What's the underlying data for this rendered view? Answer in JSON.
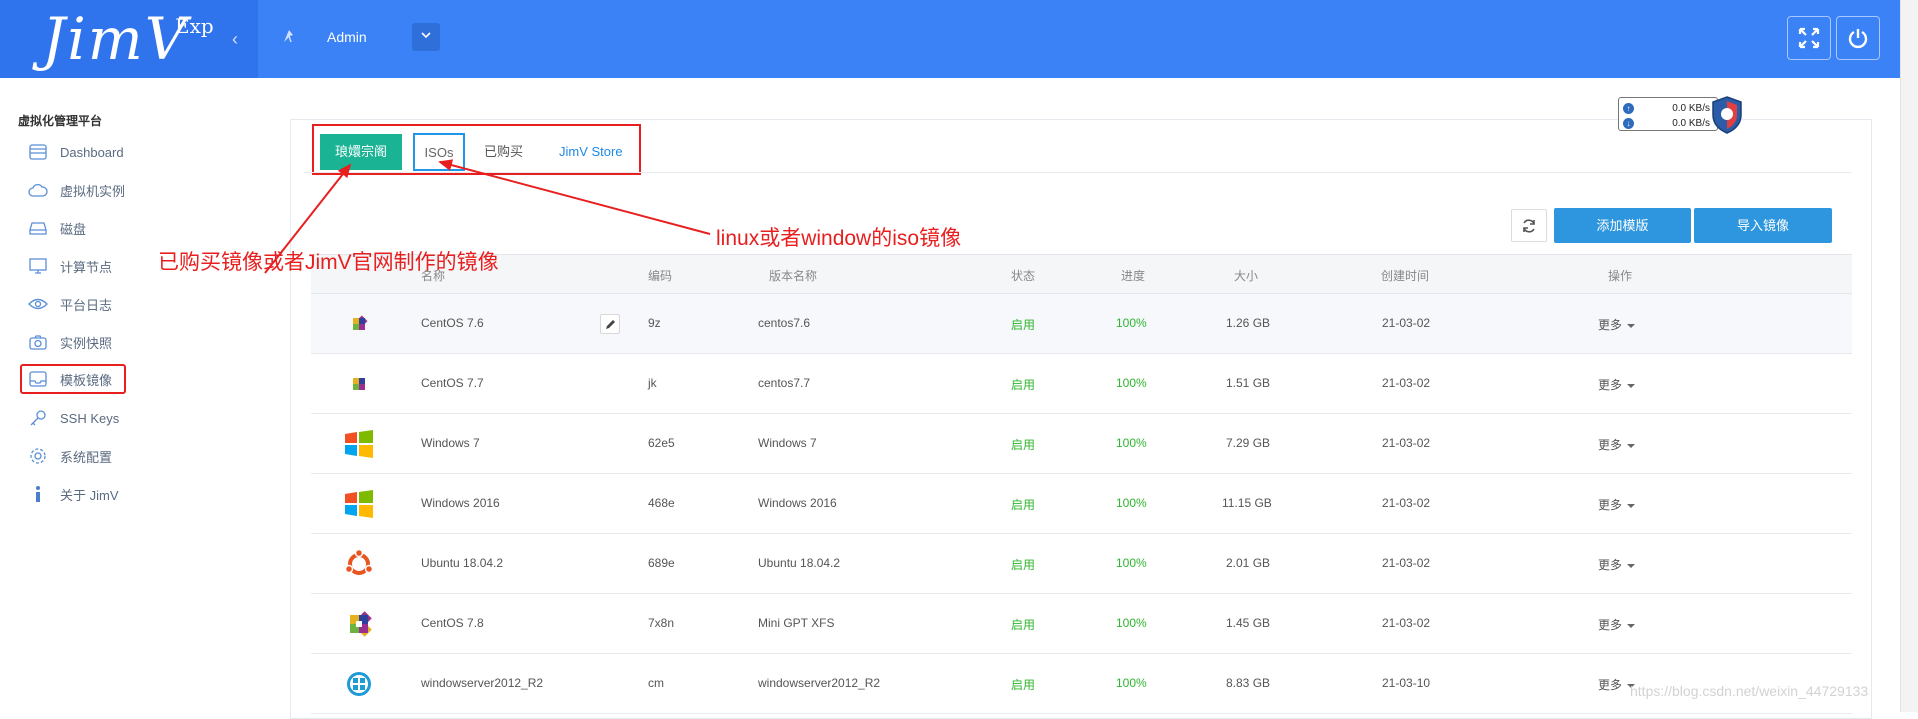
{
  "header": {
    "logo": "JimV",
    "logo_suffix": "Exp",
    "user": "Admin",
    "colors": {
      "header": "#3a82f6",
      "logo_bg": "#2f74ec"
    }
  },
  "network": {
    "up": "0.0 KB/s",
    "down": "0.0 KB/s"
  },
  "sidebar": {
    "title": "虚拟化管理平台",
    "items": [
      {
        "label": "Dashboard",
        "icon": "dashboard-icon"
      },
      {
        "label": "虚拟机实例",
        "icon": "cloud-icon"
      },
      {
        "label": "磁盘",
        "icon": "disk-icon"
      },
      {
        "label": "计算节点",
        "icon": "monitor-icon"
      },
      {
        "label": "平台日志",
        "icon": "eye-icon"
      },
      {
        "label": "实例快照",
        "icon": "camera-icon"
      },
      {
        "label": "模板镜像",
        "icon": "image-icon"
      },
      {
        "label": "SSH Keys",
        "icon": "key-icon"
      },
      {
        "label": "系统配置",
        "icon": "gear-icon"
      },
      {
        "label": "关于 JimV",
        "icon": "info-icon"
      }
    ]
  },
  "tabs": [
    "琅嬛宗阁",
    "ISOs",
    "已购买",
    "JimV Store"
  ],
  "toolbar": {
    "add": "添加模版",
    "import": "导入镜像"
  },
  "table": {
    "headers": [
      "名称",
      "编码",
      "版本名称",
      "状态",
      "进度",
      "大小",
      "创建时间",
      "操作"
    ],
    "rows": [
      {
        "name": "CentOS 7.6",
        "code": "9z",
        "version": "centos7.6",
        "status": "启用",
        "progress": "100%",
        "size": "1.26 GB",
        "created": "21-03-02",
        "action": "更多",
        "icon": "centos-icon"
      },
      {
        "name": "CentOS 7.7",
        "code": "jk",
        "version": "centos7.7",
        "status": "启用",
        "progress": "100%",
        "size": "1.51 GB",
        "created": "21-03-02",
        "action": "更多",
        "icon": "centos-icon"
      },
      {
        "name": "Windows 7",
        "code": "62e5",
        "version": "Windows 7",
        "status": "启用",
        "progress": "100%",
        "size": "7.29 GB",
        "created": "21-03-02",
        "action": "更多",
        "icon": "windows-icon"
      },
      {
        "name": "Windows 2016",
        "code": "468e",
        "version": "Windows 2016",
        "status": "启用",
        "progress": "100%",
        "size": "11.15 GB",
        "created": "21-03-02",
        "action": "更多",
        "icon": "windows-icon"
      },
      {
        "name": "Ubuntu 18.04.2",
        "code": "689e",
        "version": "Ubuntu 18.04.2",
        "status": "启用",
        "progress": "100%",
        "size": "2.01 GB",
        "created": "21-03-02",
        "action": "更多",
        "icon": "ubuntu-icon"
      },
      {
        "name": "CentOS 7.8",
        "code": "7x8n",
        "version": "Mini GPT XFS",
        "status": "启用",
        "progress": "100%",
        "size": "1.45 GB",
        "created": "21-03-02",
        "action": "更多",
        "icon": "centos-icon"
      },
      {
        "name": "windowserver2012_R2",
        "code": "cm",
        "version": "windowserver2012_R2",
        "status": "启用",
        "progress": "100%",
        "size": "8.83 GB",
        "created": "21-03-10",
        "action": "更多",
        "icon": "windows-server-icon"
      }
    ]
  },
  "annotations": {
    "left": "已购买镜像或者JimV官网制作的镜像",
    "right": "linux或者window的iso镜像",
    "color": "#e81f1f"
  },
  "watermark": "https://blog.csdn.net/weixin_44729133"
}
